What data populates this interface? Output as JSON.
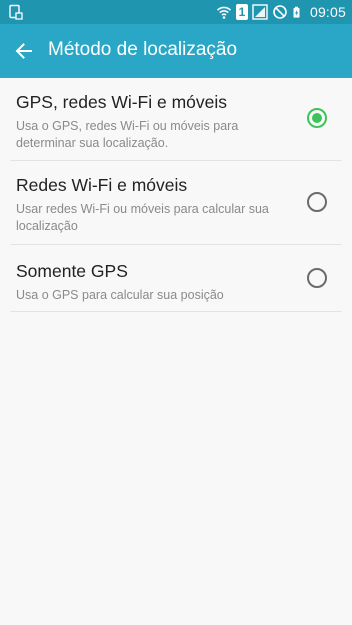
{
  "status_bar": {
    "time": "09:05",
    "sim_badge": "1",
    "left_icon": "screen-capture-icon",
    "right_icons": [
      "wifi-icon",
      "sim-1-icon",
      "signal-icon",
      "do-not-disturb-icon",
      "battery-charging-icon"
    ]
  },
  "app_bar": {
    "title": "Método de localização",
    "back_icon": "arrow-back-icon"
  },
  "options": [
    {
      "title": "GPS, redes Wi-Fi e móveis",
      "subtitle": "Usa o GPS, redes Wi-Fi ou móveis para determinar sua localização.",
      "selected": true
    },
    {
      "title": "Redes Wi-Fi e móveis",
      "subtitle": "Usar redes Wi-Fi ou móveis para calcular sua localização",
      "selected": false
    },
    {
      "title": "Somente GPS",
      "subtitle": "Usa o GPS para calcular sua posição",
      "selected": false
    }
  ],
  "colors": {
    "status_bar": "#1f95b0",
    "app_bar": "#2aa7c6",
    "background": "#f8f8f8",
    "radio_selected": "#3dc35a",
    "radio_unselected": "#6b6b6b",
    "title_text": "#222222",
    "subtitle_text": "#8a8a8a"
  }
}
